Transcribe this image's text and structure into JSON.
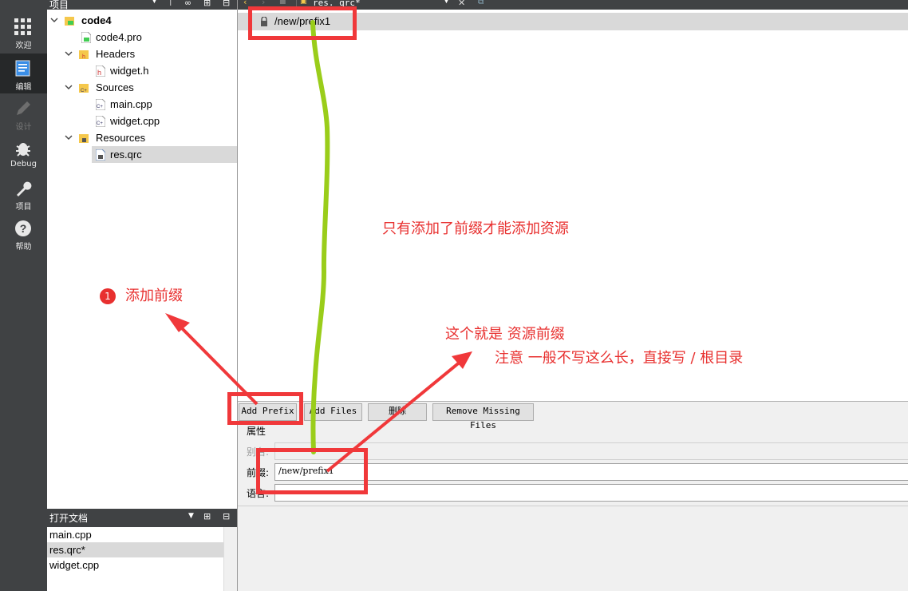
{
  "mode_bar": {
    "items": [
      {
        "label": "欢迎",
        "icon": "grid-icon",
        "active": false
      },
      {
        "label": "编辑",
        "icon": "edit-document-icon",
        "active": true
      },
      {
        "label": "设计",
        "icon": "pencil-icon",
        "active": false
      },
      {
        "label": "Debug",
        "icon": "bug-icon",
        "active": false
      },
      {
        "label": "项目",
        "icon": "wrench-icon",
        "active": false
      },
      {
        "label": "帮助",
        "icon": "help-icon",
        "active": false
      }
    ]
  },
  "project_panel": {
    "title": "项目",
    "tree": [
      {
        "label": "code4",
        "bold": true
      },
      {
        "label": "code4.pro"
      },
      {
        "label": "Headers"
      },
      {
        "label": "widget.h"
      },
      {
        "label": "Sources"
      },
      {
        "label": "main.cpp"
      },
      {
        "label": "widget.cpp"
      },
      {
        "label": "Resources"
      },
      {
        "label": "res.qrc",
        "selected": true
      }
    ]
  },
  "open_documents": {
    "title": "打开文档",
    "items": [
      {
        "label": "main.cpp"
      },
      {
        "label": "res.qrc*",
        "selected": true
      },
      {
        "label": "widget.cpp"
      }
    ]
  },
  "editor": {
    "tab_label": "res. qrc*",
    "prefix_entry": "/new/prefix1"
  },
  "resource_panel": {
    "buttons": {
      "add_prefix": "Add Prefix",
      "add_files": "Add Files",
      "delete": "删除",
      "remove_missing": "Remove Missing Files"
    },
    "section_title": "属性",
    "alias_label": "别名:",
    "prefix_label": "前缀:",
    "prefix_value": "/new/prefix1",
    "language_label": "语言:"
  },
  "annotations": {
    "badge": "1",
    "add_prefix_note": "添加前缀",
    "prefix_required_note": "只有添加了前缀才能添加资源",
    "this_is_prefix_note": "这个就是 资源前缀",
    "advice_note": "注意 一般不写这么长，直接写 /   根目录",
    "colors": {
      "red": "#f0383a",
      "green": "#9acd1a"
    }
  }
}
